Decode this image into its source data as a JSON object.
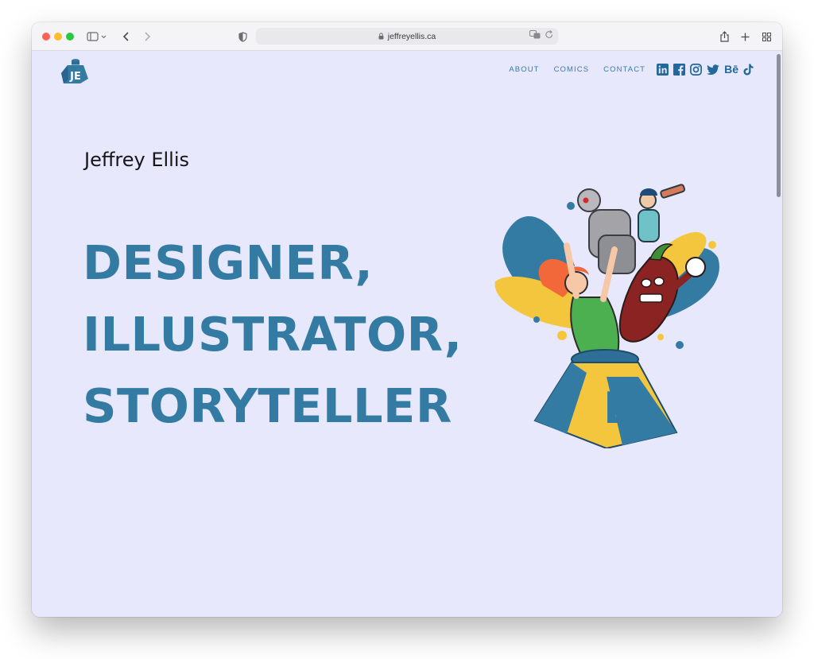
{
  "browser": {
    "url": "jeffreyellis.ca"
  },
  "site": {
    "logo_text": "JE",
    "nav": [
      "ABOUT",
      "COMICS",
      "CONTACT"
    ],
    "social": [
      {
        "name": "linkedin-icon",
        "label": "in"
      },
      {
        "name": "facebook-icon",
        "label": "f"
      },
      {
        "name": "instagram-icon",
        "label": ""
      },
      {
        "name": "twitter-icon",
        "label": ""
      },
      {
        "name": "behance-icon",
        "label": "Bē"
      },
      {
        "name": "tiktok-icon",
        "label": ""
      }
    ]
  },
  "hero": {
    "name": "Jeffrey Ellis",
    "lines": [
      "DESIGNER,",
      "ILLUSTRATOR,",
      "STORYTELLER"
    ],
    "box_letters": "JE"
  },
  "colors": {
    "background": "#e7e8fb",
    "accent_blue": "#347ba4",
    "yellow": "#f4c63d",
    "red_pepper": "#8b2323",
    "green_dress": "#4caf50"
  }
}
